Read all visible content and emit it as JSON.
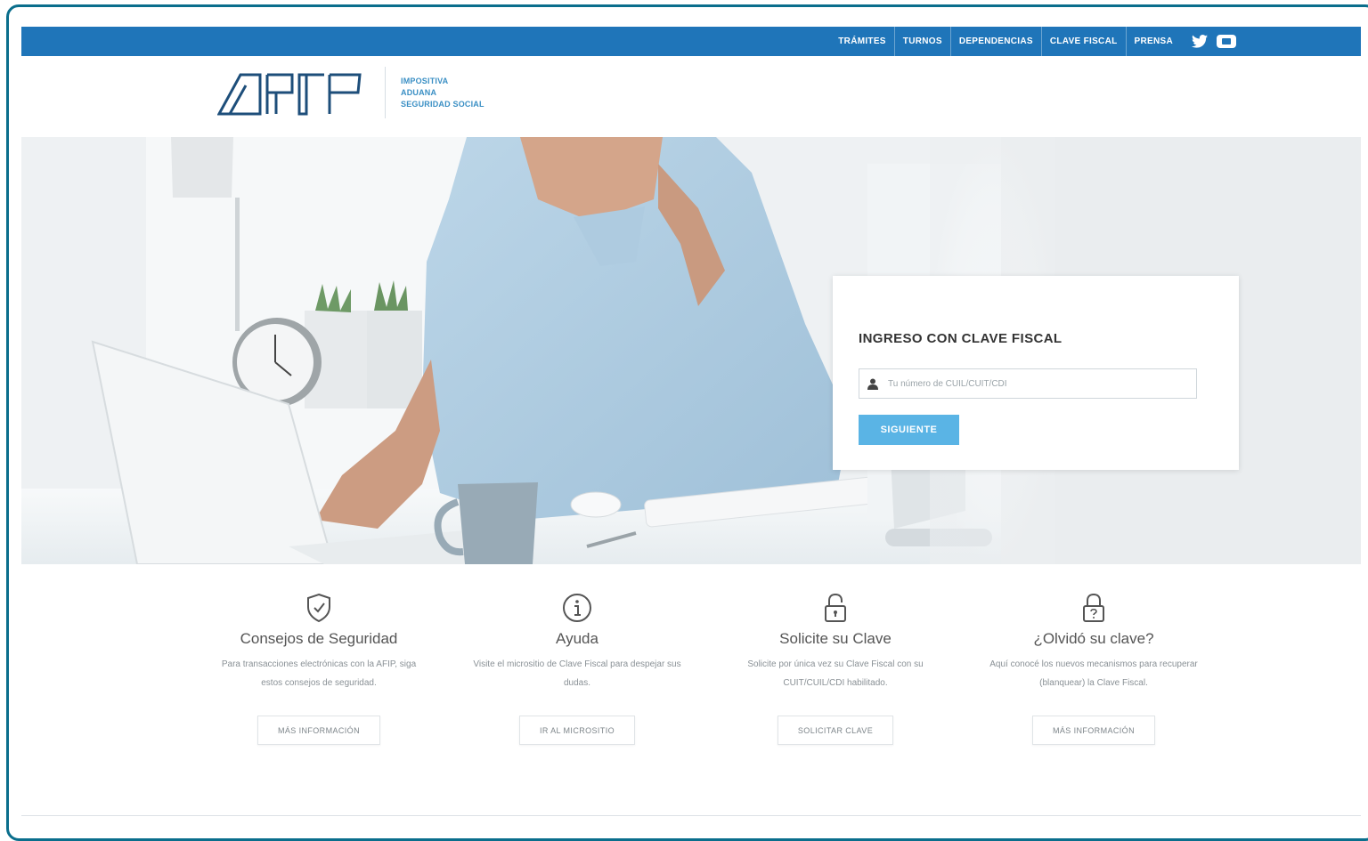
{
  "topnav": {
    "items": [
      "TRÁMITES",
      "TURNOS",
      "DEPENDENCIAS",
      "CLAVE FISCAL",
      "PRENSA"
    ],
    "social": [
      "twitter-icon",
      "youtube-icon"
    ]
  },
  "header": {
    "logo_text": "AFIP",
    "sub_lines": [
      "IMPOSITIVA",
      "ADUANA",
      "SEGURIDAD SOCIAL"
    ]
  },
  "login": {
    "title": "INGRESO CON CLAVE FISCAL",
    "placeholder": "Tu número de CUIL/CUIT/CDI",
    "button": "SIGUIENTE"
  },
  "features": [
    {
      "icon": "shield-check-icon",
      "title": "Consejos de Seguridad",
      "text": "Para transacciones electrónicas con la AFIP, siga estos consejos de seguridad.",
      "button": "MÁS INFORMACIÓN"
    },
    {
      "icon": "info-icon",
      "title": "Ayuda",
      "text": "Visite el micrositio de Clave Fiscal para despejar sus dudas.",
      "button": "IR AL MICROSITIO"
    },
    {
      "icon": "lock-icon",
      "title": "Solicite su Clave",
      "text": "Solicite por única vez su Clave Fiscal con su CUIT/CUIL/CDI habilitado.",
      "button": "SOLICITAR CLAVE"
    },
    {
      "icon": "lock-question-icon",
      "title": "¿Olvidó su clave?",
      "text": "Aquí conocé los nuevos mecanismos para recuperar (blanquear) la Clave Fiscal.",
      "button": "MÁS INFORMACIÓN"
    }
  ],
  "colors": {
    "topbar": "#1f75b9",
    "accent": "#5ab4e5",
    "logo": "#1d4e7a"
  }
}
